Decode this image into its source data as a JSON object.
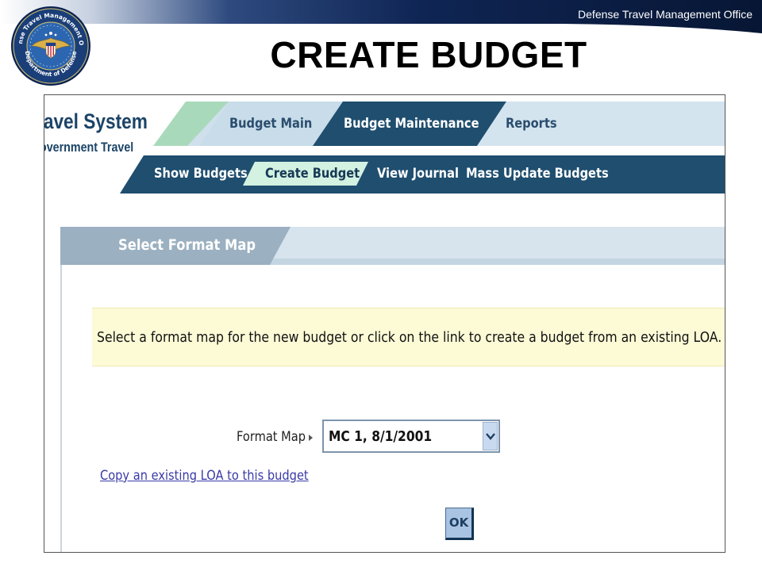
{
  "slide": {
    "office": "Defense Travel Management Office",
    "title": "CREATE BUDGET",
    "seal_text_top": "Defense Travel Management Office",
    "seal_text_bottom": "Department of Defense"
  },
  "app": {
    "brand_line1": "ravel System",
    "brand_line2": "overnment Travel"
  },
  "nav": {
    "tabs": [
      {
        "label": "Budget Main",
        "active": false
      },
      {
        "label": "Budget Maintenance",
        "active": true
      },
      {
        "label": "Reports",
        "active": false
      }
    ],
    "subtabs": [
      {
        "label": "Show Budgets",
        "active": false
      },
      {
        "label": "Create Budget",
        "active": true
      },
      {
        "label": "View Journal",
        "active": false
      },
      {
        "label": "Mass Update Budgets",
        "active": false
      }
    ]
  },
  "section": {
    "title": "Select Format Map"
  },
  "instructions": "Select a format map for the new budget or click on the link to create a budget from an existing LOA.",
  "form": {
    "format_map_label": "Format Map",
    "format_map_value": "MC 1, 8/1/2001",
    "copy_link": "Copy an existing LOA to this budget",
    "ok_label": "OK"
  },
  "colors": {
    "dark_navy": "#0a1f44",
    "tab_light": "#c8dce9",
    "tab_active": "#1f4e6f",
    "subtab_active": "#d3f2e1",
    "info_band": "#fdfbd6",
    "link": "#3a3aa8"
  }
}
